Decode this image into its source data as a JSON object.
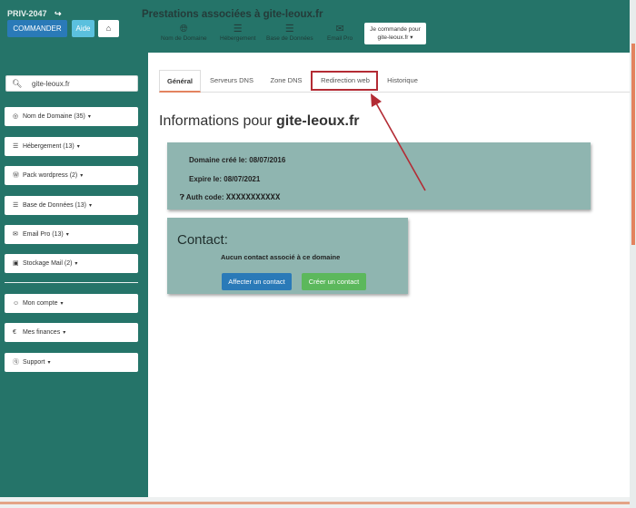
{
  "header": {
    "account_id": "PRIV-2047",
    "commander_label": "COMMANDER",
    "aide_label": "Aide",
    "page_heading": "Prestations associées à gite-leoux.fr",
    "services": [
      {
        "label": "Nom de Domaine",
        "icon": "globe-icon"
      },
      {
        "label": "Hébergement",
        "icon": "server-icon"
      },
      {
        "label": "Base de Données",
        "icon": "database-icon"
      },
      {
        "label": "Email Pro",
        "icon": "envelope-icon"
      }
    ],
    "order_line1": "Je commande pour",
    "order_line2": "gite-leoux.fr"
  },
  "sidebar": {
    "search_value": "gite-leoux.fr",
    "items": [
      {
        "label": "Nom de Domaine (35)",
        "icon": "globe-icon"
      },
      {
        "label": "Hébergement (13)",
        "icon": "server-icon"
      },
      {
        "label": "Pack wordpress (2)",
        "icon": "wordpress-icon"
      },
      {
        "label": "Base de Données (13)",
        "icon": "database-icon"
      },
      {
        "label": "Email Pro (13)",
        "icon": "envelope-icon"
      },
      {
        "label": "Stockage Mail (2)",
        "icon": "storage-icon"
      },
      {
        "label": "Mon compte",
        "icon": "user-icon"
      },
      {
        "label": "Mes finances",
        "icon": "euro-icon"
      },
      {
        "label": "Support",
        "icon": "help-icon"
      }
    ]
  },
  "tabs": [
    {
      "label": "Général",
      "active": true
    },
    {
      "label": "Serveurs DNS",
      "active": false
    },
    {
      "label": "Zone DNS",
      "active": false
    },
    {
      "label": "Redirection web",
      "active": false
    },
    {
      "label": "Historique",
      "active": false
    }
  ],
  "main": {
    "info_prefix": "Informations pour",
    "domain": "gite-leoux.fr",
    "created_label": "Domaine créé le:",
    "created_date": "08/07/2016",
    "expires_label": "Expire le:",
    "expires_date": "08/07/2021",
    "auth_label": "Auth code:",
    "auth_value": "XXXXXXXXXXX",
    "contact_title": "Contact:",
    "contact_empty": "Aucun contact associé à ce domaine",
    "assign_label": "Affecter un contact",
    "create_label": "Créer un contact"
  },
  "colors": {
    "teal": "#257469",
    "panel": "#8fb5b0",
    "primary": "#2a7ab8",
    "success": "#5cb85c",
    "info": "#5bc0de",
    "highlight": "#b32b34",
    "accent": "#e3835f"
  }
}
